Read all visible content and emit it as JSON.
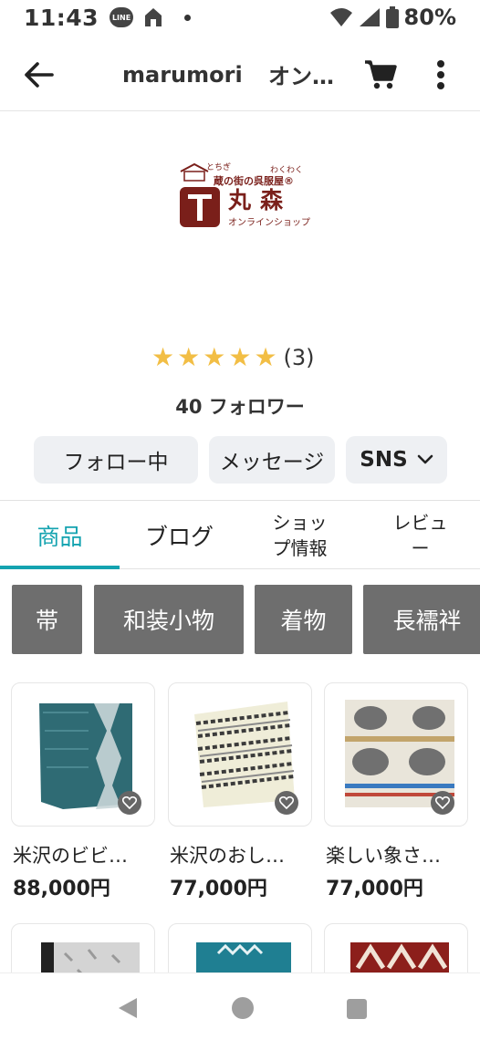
{
  "status_bar": {
    "time": "11:43",
    "line_badge": "LINE",
    "battery": "80%"
  },
  "app_bar": {
    "title": "marumori",
    "subtitle": "オン…"
  },
  "logo": {
    "reading_top": "とちぎ",
    "reading_right": "わくわく",
    "tagline": "蔵の街の呉服屋®",
    "name": "丸森",
    "sub": "オンラインショップ"
  },
  "rating": {
    "stars": 5,
    "count": "(3)"
  },
  "followers": "40 フォロワー",
  "actions": {
    "follow": "フォロー中",
    "message": "メッセージ",
    "sns": "SNS"
  },
  "tabs": [
    {
      "label": "商品",
      "active": true
    },
    {
      "label": "ブログ"
    },
    {
      "label": "ショッ\nプ情報"
    },
    {
      "label": "レビュ\nー"
    }
  ],
  "categories": [
    "帯",
    "和装小物",
    "着物",
    "長襦袢"
  ],
  "products": [
    {
      "name": "米沢のビビ…",
      "price": "88,000円"
    },
    {
      "name": "米沢のおし…",
      "price": "77,000円"
    },
    {
      "name": "楽しい象さ…",
      "price": "77,000円"
    }
  ],
  "colors": {
    "accent": "#14a3b0",
    "brand": "#7a1f1a",
    "star": "#f2be45",
    "chip_bg": "#6e6e6e"
  }
}
